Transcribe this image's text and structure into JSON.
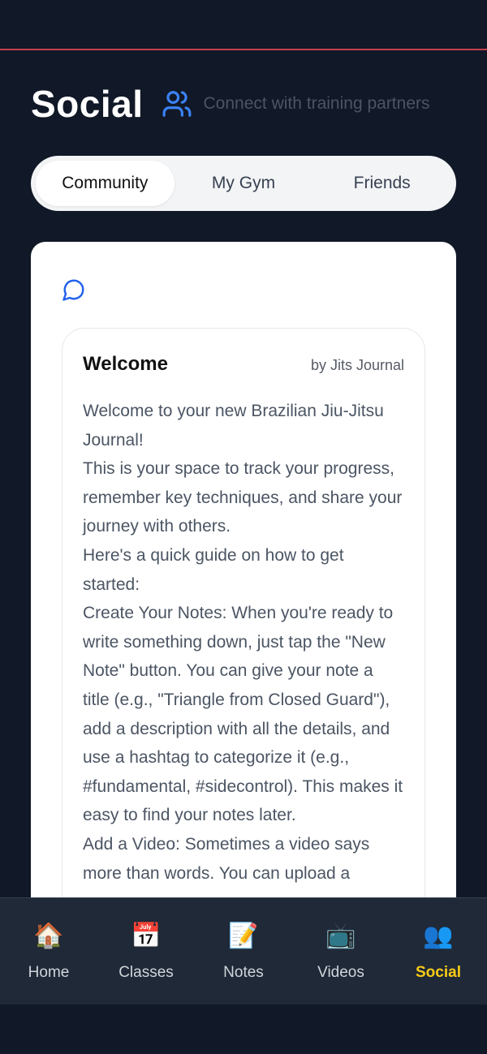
{
  "header": {
    "title": "Social",
    "subtitle": "Connect with training partners",
    "icon": "users-icon",
    "accent": "#3b82f6"
  },
  "tabs": [
    {
      "label": "Community",
      "active": true
    },
    {
      "label": "My Gym",
      "active": false
    },
    {
      "label": "Friends",
      "active": false
    }
  ],
  "feed": {
    "icon": "chat-bubble-icon",
    "post": {
      "title": "Welcome",
      "author": "by Jits Journal",
      "paragraphs": [
        "Welcome to your new Brazilian Jiu-Jitsu Journal!",
        "This is your space to track your progress, remember key techniques, and share your journey with others.",
        "Here's a quick guide on how to get started:",
        "Create Your Notes: When you're ready to write something down, just tap the \"New Note\" button. You can give your note a title (e.g., \"Triangle from Closed Guard\"), add a description with all the details, and use a hashtag to categorize it (e.g., #fundamental, #sidecontrol). This makes it easy to find your notes later.",
        "Add a Video: Sometimes a video says more than words. You can upload a"
      ]
    }
  },
  "nav": [
    {
      "label": "Home",
      "icon": "🏠",
      "active": false
    },
    {
      "label": "Classes",
      "icon": "📅",
      "active": false
    },
    {
      "label": "Notes",
      "icon": "📝",
      "active": false
    },
    {
      "label": "Videos",
      "icon": "📺",
      "active": false
    },
    {
      "label": "Social",
      "icon": "👥",
      "active": true
    }
  ],
  "colors": {
    "background": "#111827",
    "nav_active": "#facc15",
    "top_line": "#c2414b"
  }
}
